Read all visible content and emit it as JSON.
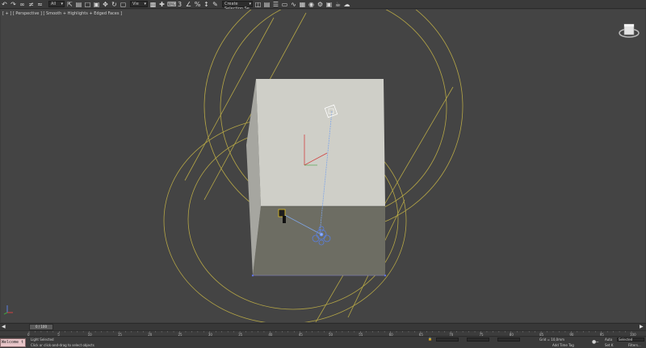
{
  "toolbar": {
    "icons": [
      "undo-icon",
      "redo-icon",
      "link-icon",
      "unlink-icon",
      "bind-icon"
    ],
    "selection_filter": "All",
    "ref_coord": "Vie",
    "selection_set": "Create Selection Se"
  },
  "viewport": {
    "label": "[ + ] [ Perspective ] [ Smooth + Highlights + Edged Faces ]"
  },
  "timeline": {
    "frame_counter": "0 / 100",
    "ticks": [
      "0",
      "5",
      "10",
      "15",
      "20",
      "25",
      "30",
      "35",
      "40",
      "45",
      "50",
      "55",
      "60",
      "65",
      "70",
      "75",
      "80",
      "85",
      "90",
      "95",
      "100"
    ]
  },
  "status": {
    "maxscript": "Welcome t",
    "selection": "Light Selected",
    "prompt": "Click or click-and-drag to select objects",
    "grid": "Grid = 10,0mm",
    "add_time_tag": "Add Time Tag",
    "auto_key": "Auto",
    "auto_key_mode": "Selected",
    "set_key": "Set K",
    "filters": "Filters..."
  },
  "colors": {
    "viewport_bg": "#444444",
    "box_front": "#cfcfc8",
    "box_side": "#a6a6a0",
    "shadow": "#6d6d63",
    "light_range": "#b5a646",
    "light_icon": "#5a7fe0",
    "maxscript_bg": "#e8c5c8"
  }
}
